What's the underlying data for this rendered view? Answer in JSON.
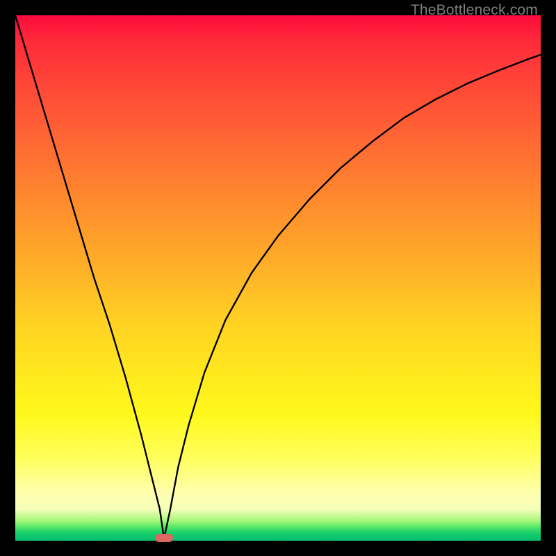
{
  "watermark": "TheBottleneck.com",
  "marker": {
    "x_frac": 0.283,
    "y_frac": 0.995
  },
  "chart_data": {
    "type": "line",
    "title": "",
    "xlabel": "",
    "ylabel": "",
    "xlim": [
      0,
      100
    ],
    "ylim": [
      0,
      100
    ],
    "grid": false,
    "legend": false,
    "note": "Black V-shaped curve over vertical red→green gradient. Values approximate (% of plot area, y=0 at bottom).",
    "series": [
      {
        "name": "curve",
        "x": [
          0,
          3,
          6,
          9,
          12,
          15,
          18,
          21,
          24,
          26,
          27.5,
          28.3,
          29.5,
          31,
          33,
          36,
          40,
          45,
          50,
          56,
          62,
          68,
          74,
          80,
          86,
          92,
          98,
          100
        ],
        "y": [
          100,
          90,
          80,
          70,
          60,
          50,
          41,
          31,
          20,
          12,
          6,
          0.4,
          6,
          14,
          22,
          32,
          42,
          51,
          58,
          65,
          71,
          76,
          80.5,
          84,
          87,
          89.5,
          91.8,
          92.5
        ]
      }
    ]
  }
}
